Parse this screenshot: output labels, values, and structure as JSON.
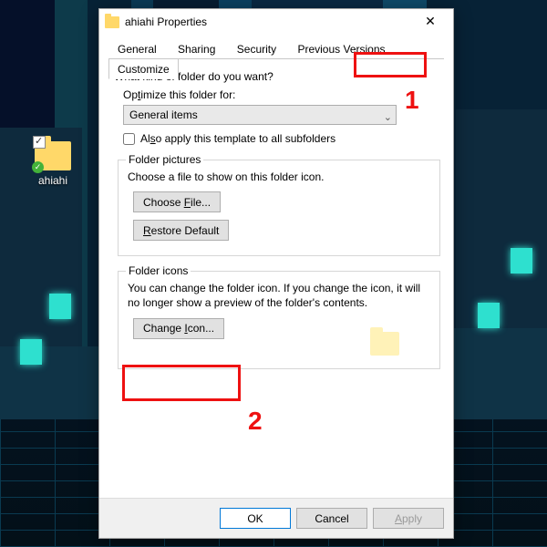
{
  "desktop": {
    "icon_label": "ahiahi"
  },
  "dialog": {
    "title": "ahiahi Properties",
    "tabs": [
      "General",
      "Sharing",
      "Security",
      "Previous Versions",
      "Customize"
    ],
    "active_tab": 4,
    "section1": {
      "question": "What kind of folder do you want?",
      "optimize_label_pre": "Op",
      "optimize_label_u": "t",
      "optimize_label_post": "imize this folder for:",
      "select_value": "General items",
      "also_apply_pre": "Al",
      "also_apply_u": "s",
      "also_apply_post": "o apply this template to all subfolders"
    },
    "section2": {
      "legend": "Folder pictures",
      "desc": "Choose a file to show on this folder icon.",
      "choose_pre": "Choose ",
      "choose_u": "F",
      "choose_post": "ile...",
      "restore_pre": "",
      "restore_u": "R",
      "restore_post": "estore Default"
    },
    "section3": {
      "legend": "Folder icons",
      "desc": "You can change the folder icon. If you change the icon, it will no longer show a preview of the folder's contents.",
      "change_pre": "Change ",
      "change_u": "I",
      "change_post": "con..."
    },
    "buttons": {
      "ok": "OK",
      "cancel": "Cancel",
      "apply_u": "A",
      "apply_post": "pply"
    }
  },
  "annotations": {
    "n1": "1",
    "n2": "2"
  }
}
